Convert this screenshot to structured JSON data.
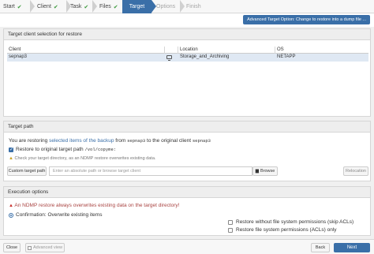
{
  "steps": [
    {
      "label": "Start",
      "done": true
    },
    {
      "label": "Client",
      "done": true
    },
    {
      "label": "Task",
      "done": true
    },
    {
      "label": "Files",
      "done": true
    },
    {
      "label": "Target",
      "active": true
    },
    {
      "label": "Options",
      "disabled": true
    },
    {
      "label": "Finish",
      "disabled": true
    }
  ],
  "advanced_target_button": "Advanced Target Option: Change to restore into a dump file ...",
  "client_panel": {
    "title": "Target client selection for restore",
    "columns": [
      "Client",
      "Location",
      "OS"
    ],
    "rows": [
      {
        "client": "sepnap3",
        "location": "Storage_and_Archiving",
        "os": "NETAPP"
      }
    ]
  },
  "target_path": {
    "title": "Target path",
    "restoring_prefix": "You are restoring",
    "restoring_link": "selected items of the backup",
    "restoring_from": "from",
    "source_client": "sepnap3",
    "restoring_to": "to the original client",
    "target_client": "sepnap3",
    "restore_original_label": "Restore to original target path",
    "restore_original_path": "/vol/copyme:",
    "restore_original_checked": true,
    "warning": "Check your target directory, as an NDMP restore overwrites existing data.",
    "custom_button": "Custom target path",
    "path_placeholder": "Enter an absolute path or browse target client",
    "browse_button": "Browse",
    "relocation_button": "Relocation"
  },
  "execution": {
    "title": "Execution options",
    "warning": "An NDMP restore always overwrites existing data on the target directory!",
    "confirm_label": "Confirmation: Overwrite existing items",
    "opt_no_acl": "Restore without file system permissions (skip ACLs)",
    "opt_acl_only": "Restore file system permissions (ACLs) only",
    "opt_no_acl_checked": false,
    "opt_acl_only_checked": false
  },
  "footer": {
    "close": "Close",
    "advanced_view": "Advanced view",
    "back": "Back",
    "next": "Next"
  },
  "colors": {
    "accent": "#3a6fa8",
    "success": "#3c9a3c",
    "warning": "#c9a227",
    "danger": "#c9302c",
    "selected_row": "#dfe8f3"
  }
}
